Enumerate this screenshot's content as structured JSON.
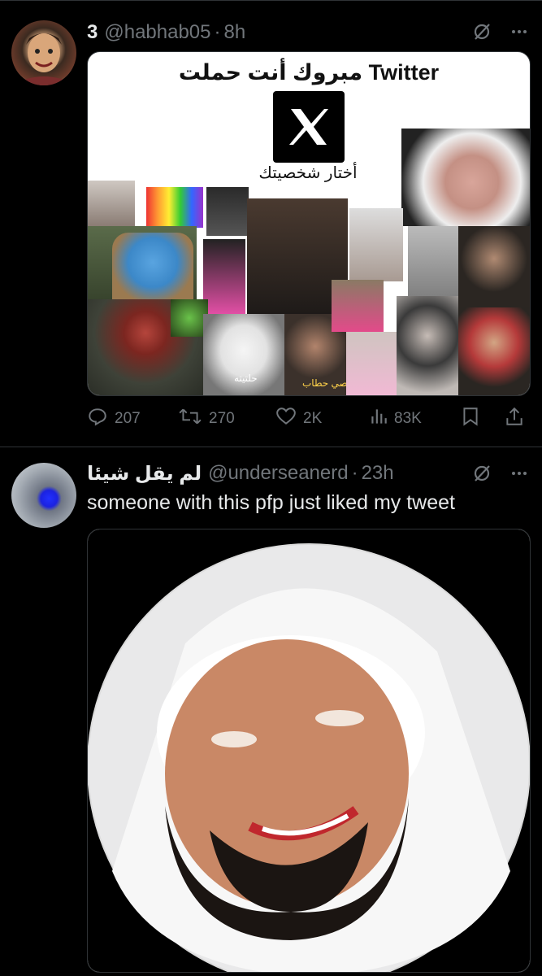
{
  "tweets": [
    {
      "display_name": "3",
      "handle": "@habhab05",
      "separator": "·",
      "time": "8h",
      "media": {
        "caption_ar": "مبروك أنت حملت Twitter",
        "choose_ar": "أختار شخصيتك",
        "tile_label_1_ar": "حلتيته",
        "tile_label_2_ar": "قصي حطاب"
      },
      "stats": {
        "replies": "207",
        "reposts": "270",
        "likes": "2K",
        "views": "83K"
      },
      "icons": [
        "grok-icon",
        "more-icon",
        "reply-icon",
        "repost-icon",
        "like-icon",
        "views-icon",
        "bookmark-icon",
        "share-icon"
      ]
    },
    {
      "display_name": "لم يقل شيئا",
      "handle": "@underseanerd",
      "separator": "·",
      "time": "23h",
      "text": "someone with this pfp just liked my tweet",
      "icons": [
        "grok-icon",
        "more-icon"
      ]
    }
  ],
  "colors": {
    "background": "#000000",
    "text": "#e7e9ea",
    "muted": "#71767b",
    "border": "#2f3336"
  }
}
